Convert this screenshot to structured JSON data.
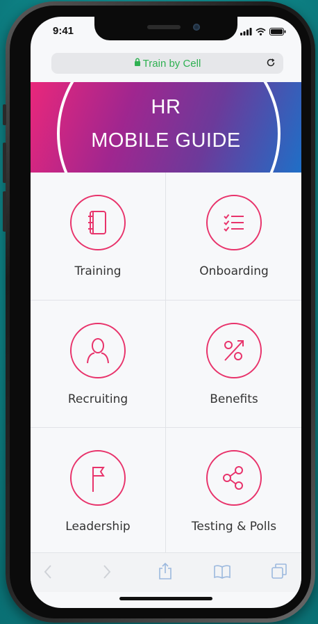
{
  "status_bar": {
    "time": "9:41"
  },
  "browser": {
    "url": "Train by Cell"
  },
  "banner": {
    "title_line1": "HR",
    "title_line2": "MOBILE GUIDE"
  },
  "menu": {
    "items": [
      {
        "label": "Training",
        "icon": "notebook-icon"
      },
      {
        "label": "Onboarding",
        "icon": "checklist-icon"
      },
      {
        "label": "Recruiting",
        "icon": "person-icon"
      },
      {
        "label": "Benefits",
        "icon": "percent-icon"
      },
      {
        "label": "Leadership",
        "icon": "flag-icon"
      },
      {
        "label": "Testing & Polls",
        "icon": "share-icon"
      }
    ]
  },
  "colors": {
    "accent": "#e8336b",
    "banner_gradient": [
      "#e9277b",
      "#a0268f",
      "#6c3a9a",
      "#1f6fc7"
    ],
    "url_green": "#2fb152"
  }
}
